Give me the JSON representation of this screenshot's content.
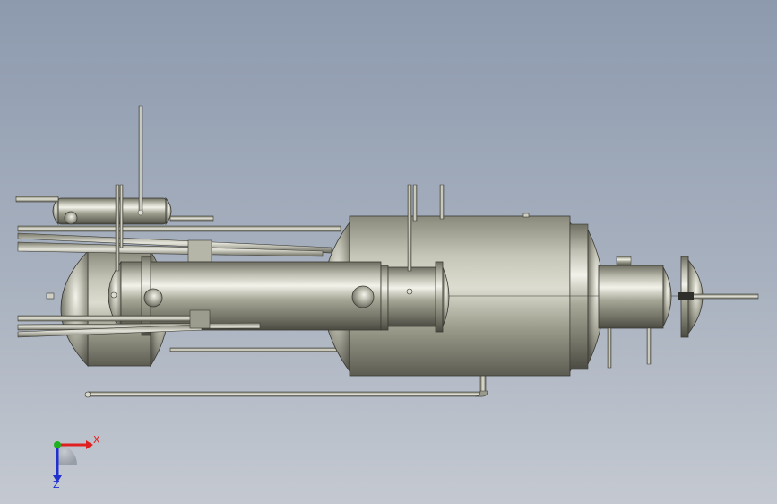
{
  "viewport": {
    "background_top": "#8d9aae",
    "background_bottom": "#c4c9d1"
  },
  "triad": {
    "x_label": "X",
    "z_label": "Z",
    "x_color": "#e02020",
    "y_color": "#20b020",
    "z_color": "#2030d0"
  },
  "model": {
    "icon": "pressure-vessel-assembly-model"
  }
}
